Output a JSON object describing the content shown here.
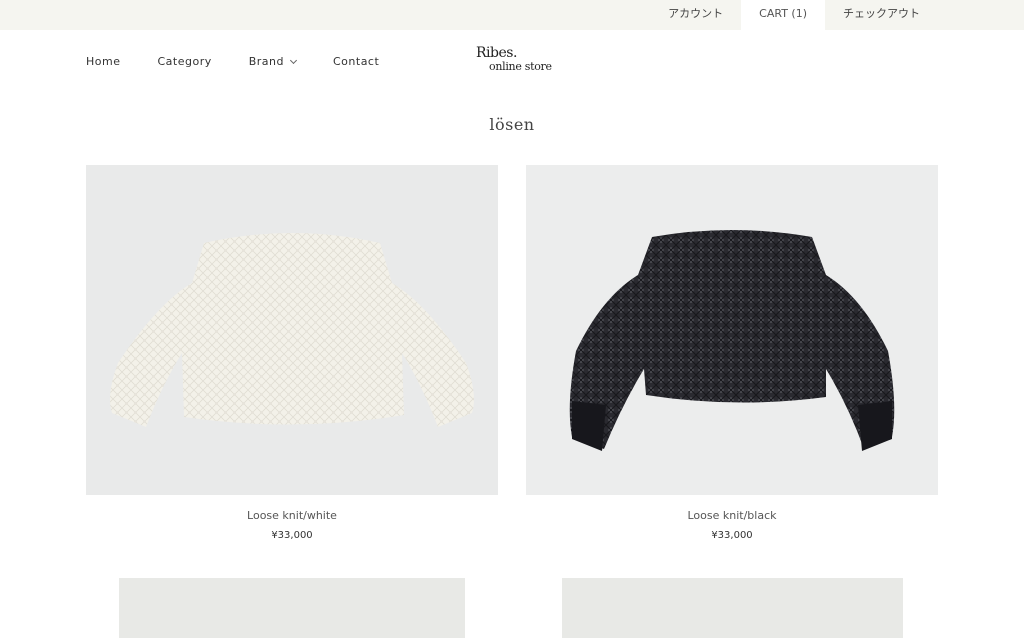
{
  "topbar": {
    "account": "アカウント",
    "cart": "CART (1)",
    "checkout": "チェックアウト"
  },
  "nav": {
    "home": "Home",
    "category": "Category",
    "brand": "Brand",
    "contact": "Contact"
  },
  "logo": {
    "line1": "Ribes.",
    "line2": "online store"
  },
  "page": {
    "title": "lösen"
  },
  "products": [
    {
      "name": "Loose knit/white",
      "price": "¥33,000"
    },
    {
      "name": "Loose knit/black",
      "price": "¥33,000"
    }
  ],
  "colors": {
    "topbar_bg": "#f5f5f0",
    "knit_white": "#f3f1e9",
    "knit_black": "#17171c",
    "photo_bg": "#e9eaea"
  }
}
